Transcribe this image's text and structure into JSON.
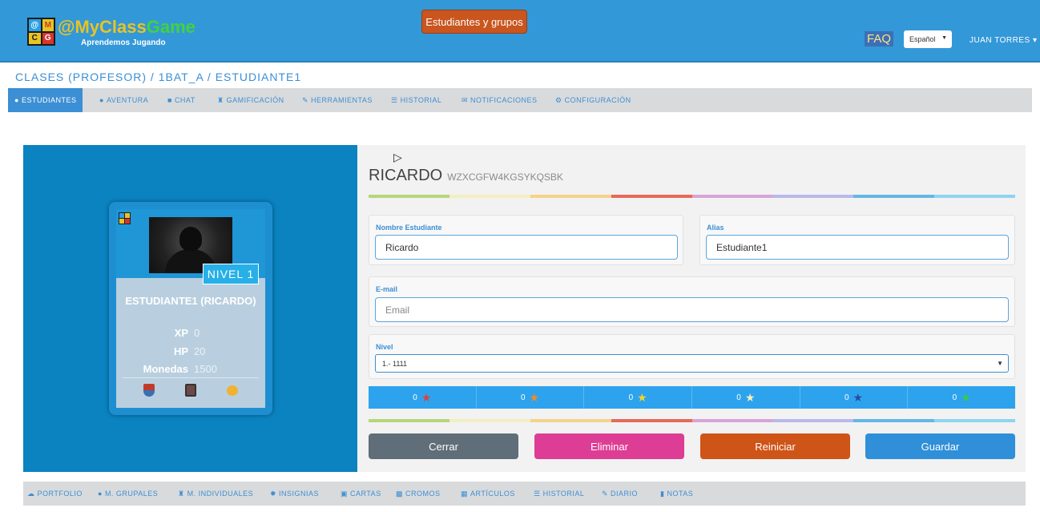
{
  "header": {
    "logo_letters": [
      "@",
      "M",
      "C",
      "G"
    ],
    "brand_at": "@",
    "brand_my": "My",
    "brand_class": "Class",
    "brand_game": "Game",
    "slogan": "Aprendemos Jugando",
    "center_button": "Estudiantes y grupos",
    "faq": "FAQ",
    "language": "Español",
    "user": "JUAN TORRES"
  },
  "breadcrumb": "CLASES (PROFESOR) / 1BAT_A / ESTUDIANTE1",
  "tabs": [
    {
      "label": "ESTUDIANTES",
      "icon": "user-icon",
      "active": true
    },
    {
      "label": "AVENTURA",
      "icon": "globe-icon"
    },
    {
      "label": "CHAT",
      "icon": "chat-icon"
    },
    {
      "label": "GAMIFICACIÓN",
      "icon": "castle-icon"
    },
    {
      "label": "HERRAMIENTAS",
      "icon": "wrench-icon"
    },
    {
      "label": "HISTORIAL",
      "icon": "list-icon"
    },
    {
      "label": "NOTIFICACIONES",
      "icon": "envelope-icon"
    },
    {
      "label": "CONFIGURACIÓN",
      "icon": "gear-icon"
    }
  ],
  "card": {
    "nivel": "NIVEL 1",
    "name": "ESTUDIANTE1 (RICARDO)",
    "stats": [
      {
        "label": "XP",
        "value": "0"
      },
      {
        "label": "HP",
        "value": "20"
      },
      {
        "label": "Monedas",
        "value": "1500"
      }
    ]
  },
  "form": {
    "title": "RICARDO",
    "code": "WZXCGFW4KGSYKQSBK",
    "nombre_label": "Nombre Estudiante",
    "nombre_value": "Ricardo",
    "alias_label": "Alias",
    "alias_value": "Estudiante1",
    "email_label": "E-mail",
    "email_placeholder": "Email",
    "nivel_label": "Nivel",
    "nivel_value": "1.- 1111"
  },
  "badges": [
    {
      "count": "0",
      "color": "#e0403a"
    },
    {
      "count": "0",
      "color": "#f08a24"
    },
    {
      "count": "0",
      "color": "#f2d32c"
    },
    {
      "count": "0",
      "color": "#f4f0b8"
    },
    {
      "count": "0",
      "color": "#2a4aa0"
    },
    {
      "count": "0",
      "color": "#3cc84a"
    }
  ],
  "buttons": {
    "cerrar": "Cerrar",
    "eliminar": "Eliminar",
    "reiniciar": "Reiniciar",
    "guardar": "Guardar"
  },
  "bottom_tabs": [
    {
      "label": "PORTFOLIO",
      "icon": "cloud-icon"
    },
    {
      "label": "M. GRUPALES",
      "icon": "globe-icon"
    },
    {
      "label": "M. INDIVIDUALES",
      "icon": "castle-icon"
    },
    {
      "label": "INSIGNIAS",
      "icon": "certificate-icon"
    },
    {
      "label": "CARTAS",
      "icon": "card-icon"
    },
    {
      "label": "CROMOS",
      "icon": "book-icon"
    },
    {
      "label": "ARTÍCULOS",
      "icon": "items-icon"
    },
    {
      "label": "HISTORIAL",
      "icon": "list-icon"
    },
    {
      "label": "DIARIO",
      "icon": "pencil-icon"
    },
    {
      "label": "NOTAS",
      "icon": "bar-chart-icon"
    }
  ],
  "colors": {
    "header_blue": "#3398d8",
    "accent": "#3b8fd4",
    "cerrar": "#5f6e78",
    "eliminar": "#dd3d94",
    "reiniciar": "#cf5418",
    "guardar": "#2f8fd8"
  }
}
